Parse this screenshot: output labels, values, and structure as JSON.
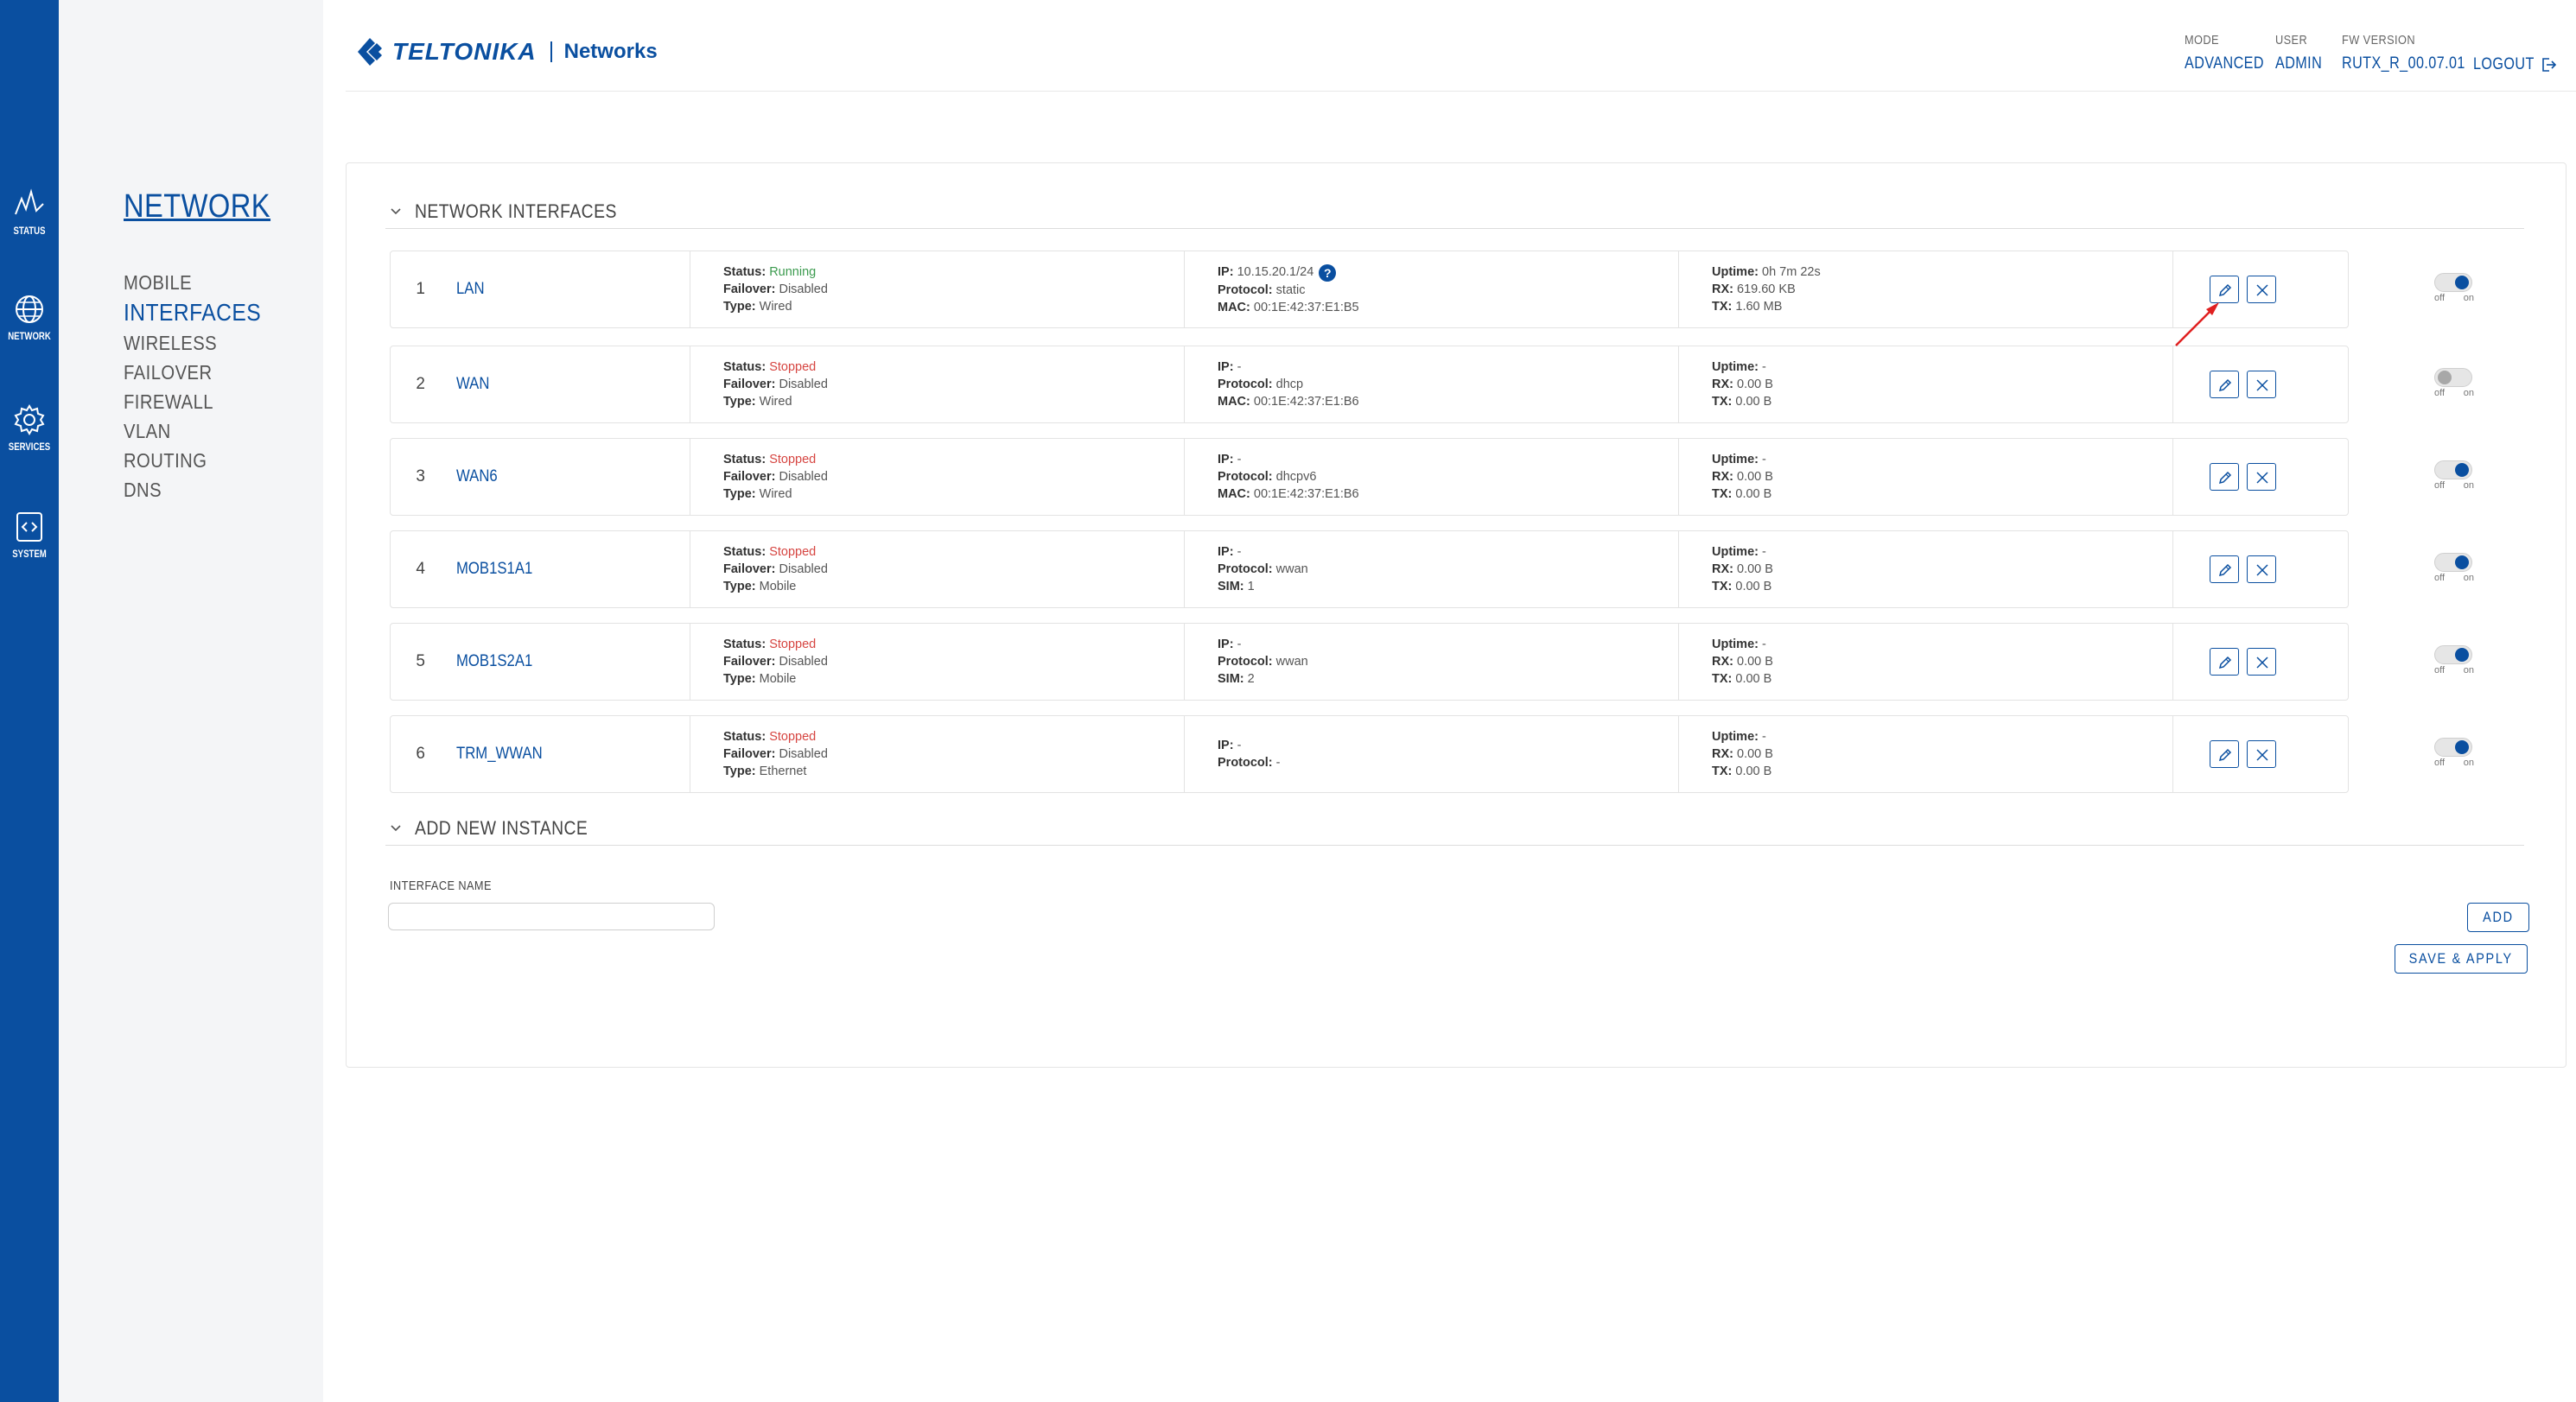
{
  "rail": {
    "items": [
      {
        "label": "STATUS",
        "icon": "status-icon"
      },
      {
        "label": "NETWORK",
        "icon": "globe-icon"
      },
      {
        "label": "SERVICES",
        "icon": "gear-icon"
      },
      {
        "label": "SYSTEM",
        "icon": "code-icon"
      }
    ],
    "active": "NETWORK",
    "color": "#0a4fa0"
  },
  "subnav": {
    "title": "NETWORK",
    "items": [
      "MOBILE",
      "INTERFACES",
      "WIRELESS",
      "FAILOVER",
      "FIREWALL",
      "VLAN",
      "ROUTING",
      "DNS"
    ],
    "active": "INTERFACES"
  },
  "header": {
    "brand": "TELTONIKA",
    "sub": "Networks",
    "mode_label": "MODE",
    "mode_value": "ADVANCED",
    "user_label": "USER",
    "user_value": "ADMIN",
    "fw_label": "FW VERSION",
    "fw_value": "RUTX_R_00.07.01",
    "logout": "LOGOUT"
  },
  "sections": {
    "interfaces_title": "NETWORK INTERFACES",
    "add_title": "ADD NEW INSTANCE"
  },
  "labels": {
    "status": "Status:",
    "failover": "Failover:",
    "type": "Type:",
    "ip": "IP:",
    "protocol": "Protocol:",
    "mac": "MAC:",
    "sim": "SIM:",
    "uptime": "Uptime:",
    "rx": "RX:",
    "tx": "TX:",
    "off": "off",
    "on": "on",
    "help": "?"
  },
  "interfaces": [
    {
      "num": "1",
      "name": "LAN",
      "status": "Running",
      "failover": "Disabled",
      "type": "Wired",
      "ip": "10.15.20.1/24",
      "protocol": "static",
      "extra_label": "MAC:",
      "extra": "00:1E:42:37:E1:B5",
      "uptime": "0h 7m 22s",
      "rx": "619.60 KB",
      "tx": "1.60 MB",
      "enabled": true
    },
    {
      "num": "2",
      "name": "WAN",
      "status": "Stopped",
      "failover": "Disabled",
      "type": "Wired",
      "ip": "-",
      "protocol": "dhcp",
      "extra_label": "MAC:",
      "extra": "00:1E:42:37:E1:B6",
      "uptime": "-",
      "rx": "0.00 B",
      "tx": "0.00 B",
      "enabled": false
    },
    {
      "num": "3",
      "name": "WAN6",
      "status": "Stopped",
      "failover": "Disabled",
      "type": "Wired",
      "ip": "-",
      "protocol": "dhcpv6",
      "extra_label": "MAC:",
      "extra": "00:1E:42:37:E1:B6",
      "uptime": "-",
      "rx": "0.00 B",
      "tx": "0.00 B",
      "enabled": true
    },
    {
      "num": "4",
      "name": "MOB1S1A1",
      "status": "Stopped",
      "failover": "Disabled",
      "type": "Mobile",
      "ip": "-",
      "protocol": "wwan",
      "extra_label": "SIM:",
      "extra": "1",
      "uptime": "-",
      "rx": "0.00 B",
      "tx": "0.00 B",
      "enabled": true
    },
    {
      "num": "5",
      "name": "MOB1S2A1",
      "status": "Stopped",
      "failover": "Disabled",
      "type": "Mobile",
      "ip": "-",
      "protocol": "wwan",
      "extra_label": "SIM:",
      "extra": "2",
      "uptime": "-",
      "rx": "0.00 B",
      "tx": "0.00 B",
      "enabled": true
    },
    {
      "num": "6",
      "name": "TRM_WWAN",
      "status": "Stopped",
      "failover": "Disabled",
      "type": "Ethernet",
      "ip": "-",
      "protocol": "-",
      "extra_label": "",
      "extra": "",
      "uptime": "-",
      "rx": "0.00 B",
      "tx": "0.00 B",
      "enabled": true
    }
  ],
  "add_instance": {
    "field_label": "INTERFACE NAME",
    "value": "",
    "add_label": "ADD",
    "save_label": "SAVE & APPLY"
  },
  "colors": {
    "accent": "#0a4fa0",
    "running": "#3c9b4f",
    "stopped": "#d64541",
    "annotation_arrow": "#e02020"
  }
}
